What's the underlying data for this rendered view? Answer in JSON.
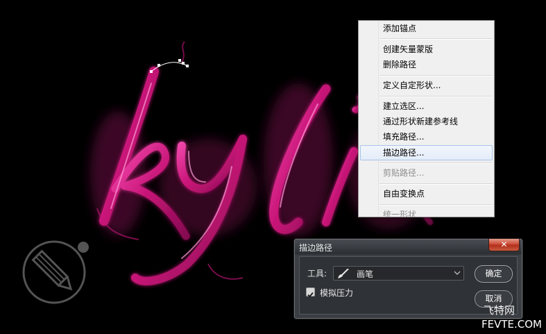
{
  "context_menu": {
    "items": [
      {
        "label": "添加锚点",
        "state": "normal"
      },
      {
        "label": "创建矢量蒙版",
        "state": "normal"
      },
      {
        "label": "删除路径",
        "state": "normal"
      },
      {
        "label": "定义自定形状...",
        "state": "normal"
      },
      {
        "label": "建立选区...",
        "state": "normal"
      },
      {
        "label": "通过形状新建参考线",
        "state": "normal"
      },
      {
        "label": "填充路径...",
        "state": "normal"
      },
      {
        "label": "描边路径...",
        "state": "hover"
      },
      {
        "label": "剪贴路径...",
        "state": "disabled"
      },
      {
        "label": "自由变换点",
        "state": "normal"
      },
      {
        "label": "统一形状",
        "state": "disabled"
      }
    ]
  },
  "dialog": {
    "title": "描边路径",
    "close_glyph": "✕",
    "tool_label": "工具:",
    "tool_value": "画笔",
    "tool_icon": "brush-icon",
    "simulate_pressure_label": "模拟压力",
    "simulate_pressure_checked": true,
    "ok_label": "确定",
    "cancel_label": "取消"
  },
  "canvas": {
    "artwork_text": "kyli",
    "artwork_color": "#e0258f"
  },
  "watermark": {
    "logo": "pencil-logo-icon",
    "brand": "飞特网",
    "site": "FEVTE.COM"
  }
}
